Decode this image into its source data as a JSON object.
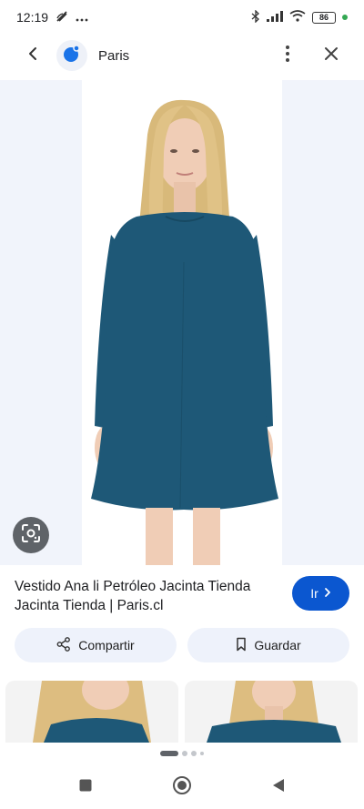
{
  "status": {
    "time": "12:19",
    "battery": "86"
  },
  "header": {
    "site_name": "Paris"
  },
  "result": {
    "title": "Vestido Ana li Petróleo Jacinta Tienda Jacinta Tienda | Paris.cl",
    "go_label": "Ir"
  },
  "actions": {
    "share_label": "Compartir",
    "save_label": "Guardar"
  },
  "colors": {
    "accent": "#0b57d0",
    "dress": "#1e5877",
    "chip_bg": "#eef2fb"
  },
  "icons": {
    "status_left": [
      "wifi-calling-icon",
      "more-dots-icon"
    ],
    "status_right": [
      "bluetooth-icon",
      "signal-icon",
      "wifi-icon",
      "battery-icon"
    ],
    "toolbar": [
      "back-arrow-icon",
      "site-logo-icon",
      "more-vert-icon",
      "close-icon"
    ],
    "actions": [
      "share-icon",
      "bookmark-icon"
    ],
    "nav": [
      "recents-square-icon",
      "home-circle-icon",
      "back-triangle-icon"
    ]
  }
}
